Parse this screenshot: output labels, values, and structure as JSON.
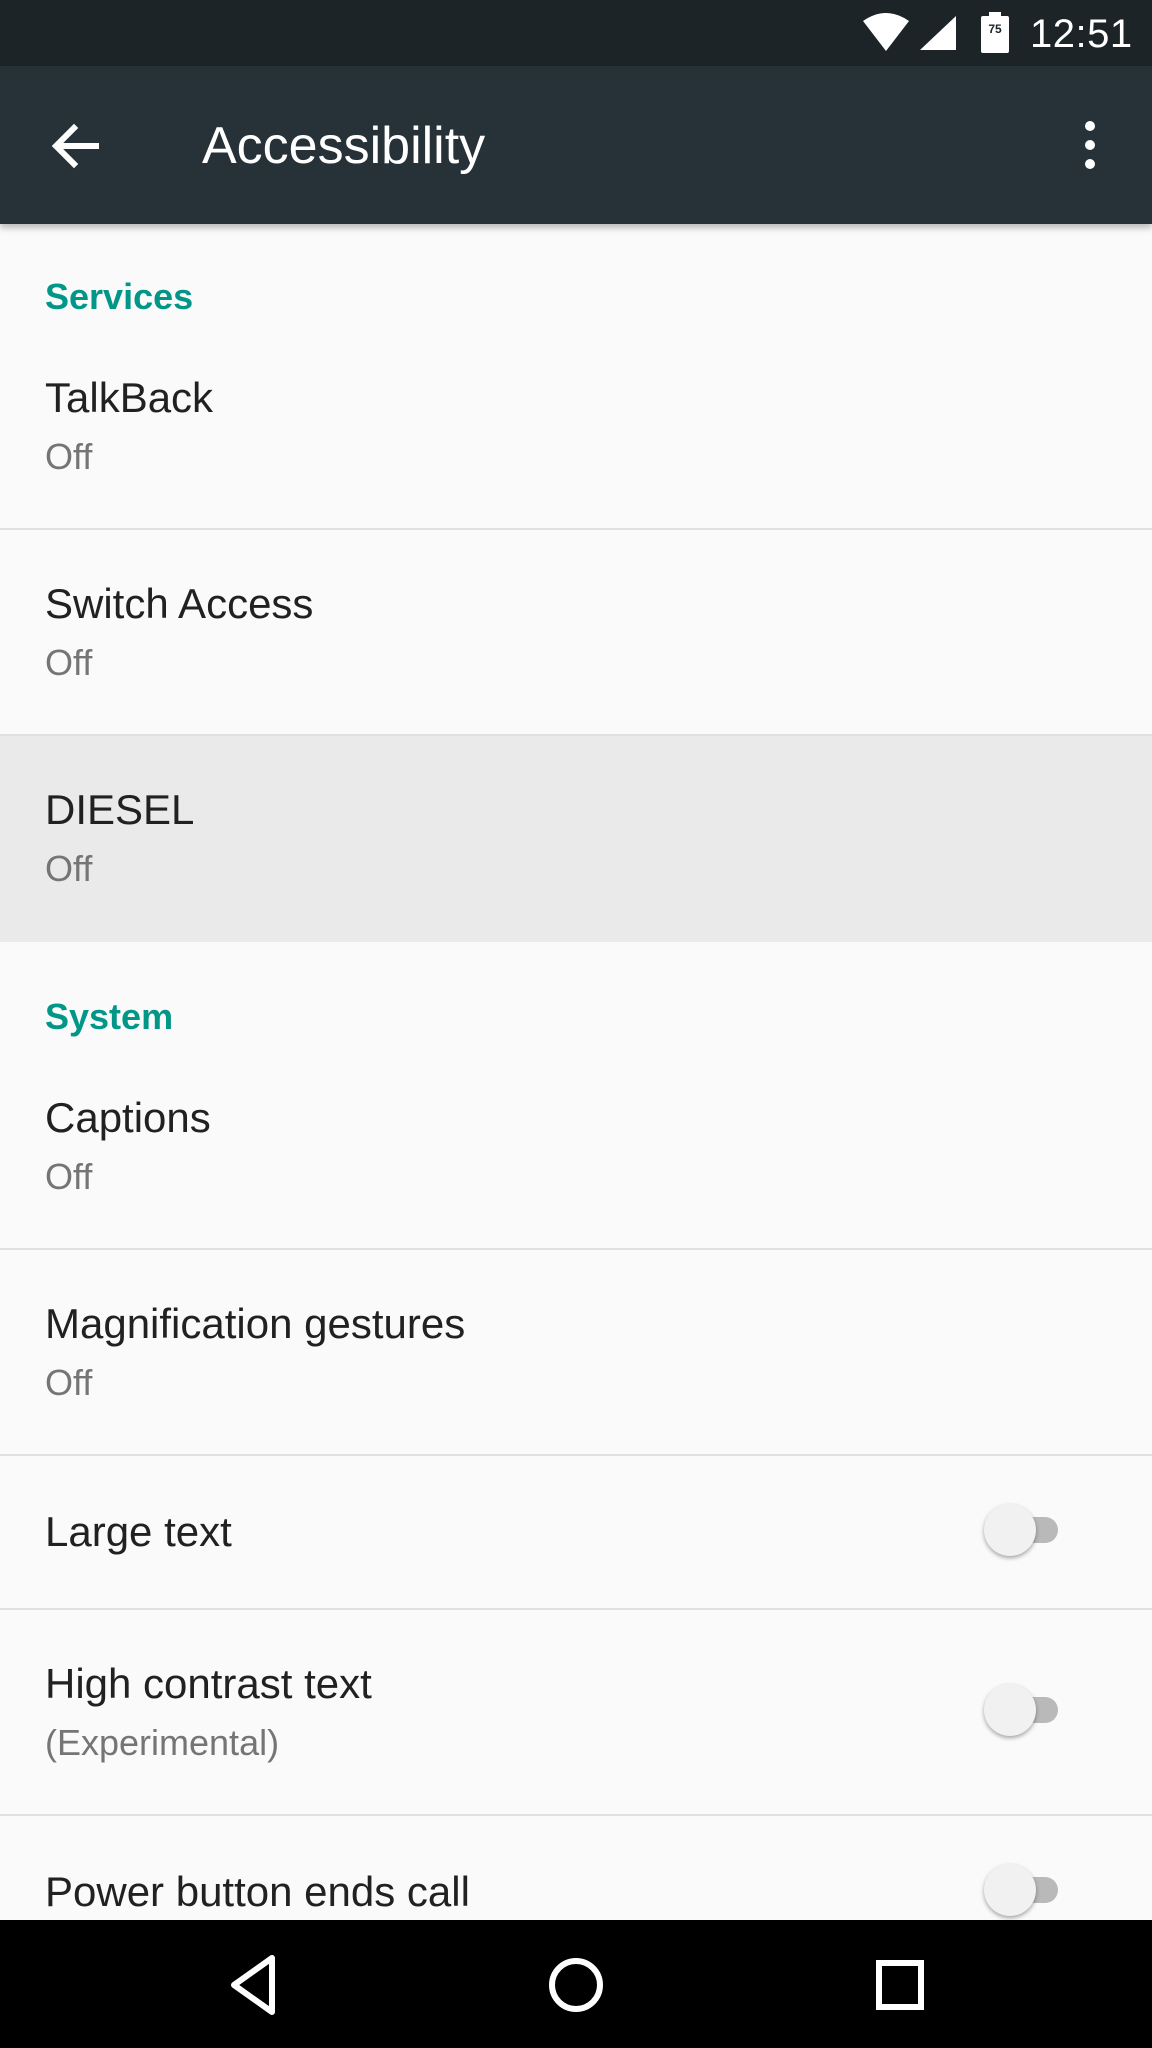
{
  "status_bar": {
    "time": "12:51",
    "battery_level": "75",
    "icons": [
      "wifi-icon",
      "cell-signal-icon",
      "battery-icon"
    ]
  },
  "app_bar": {
    "title": "Accessibility",
    "back_icon": "arrow-back-icon",
    "overflow_icon": "more-vert-icon"
  },
  "sections": {
    "services": {
      "header": "Services",
      "items": [
        {
          "title": "TalkBack",
          "summary": "Off"
        },
        {
          "title": "Switch Access",
          "summary": "Off"
        },
        {
          "title": "DIESEL",
          "summary": "Off"
        }
      ]
    },
    "system": {
      "header": "System",
      "items": [
        {
          "title": "Captions",
          "summary": "Off"
        },
        {
          "title": "Magnification gestures",
          "summary": "Off"
        }
      ],
      "toggles": [
        {
          "title": "Large text",
          "summary": "",
          "on": false
        },
        {
          "title": "High contrast text",
          "summary": "(Experimental)",
          "on": false
        },
        {
          "title": "Power button ends call",
          "summary": "",
          "on": false
        }
      ]
    }
  },
  "nav_bar": {
    "icons": [
      "back-triangle-icon",
      "home-circle-icon",
      "recents-square-icon"
    ]
  },
  "colors": {
    "status_bar": "#1c2428",
    "app_bar": "#263238",
    "accent": "#009688",
    "background": "#fafafa",
    "pressed_row": "#eaeaea"
  }
}
